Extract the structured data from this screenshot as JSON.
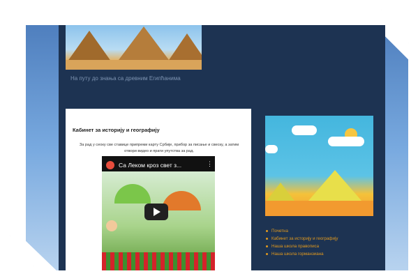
{
  "header": {
    "description": "На путу до знања са древним Египћанима"
  },
  "post": {
    "title": "Кабинет за историју и географију",
    "text": "За рад у сеоку све ставице припреми карту Србије, прибор за писање и свеску, а затим отвори видео и прати упутства за рад.",
    "video": {
      "title": "Са Леком кроз свет з...",
      "menu_glyph": "⋮"
    }
  },
  "sidebar": {
    "nav_items": [
      "Почетна",
      "Кабинет за историју и географију",
      "Наша школа правописа",
      "Наша школа горманзиана"
    ]
  },
  "colors": {
    "page_bg": "#1d3352",
    "link": "#e39a1d"
  }
}
